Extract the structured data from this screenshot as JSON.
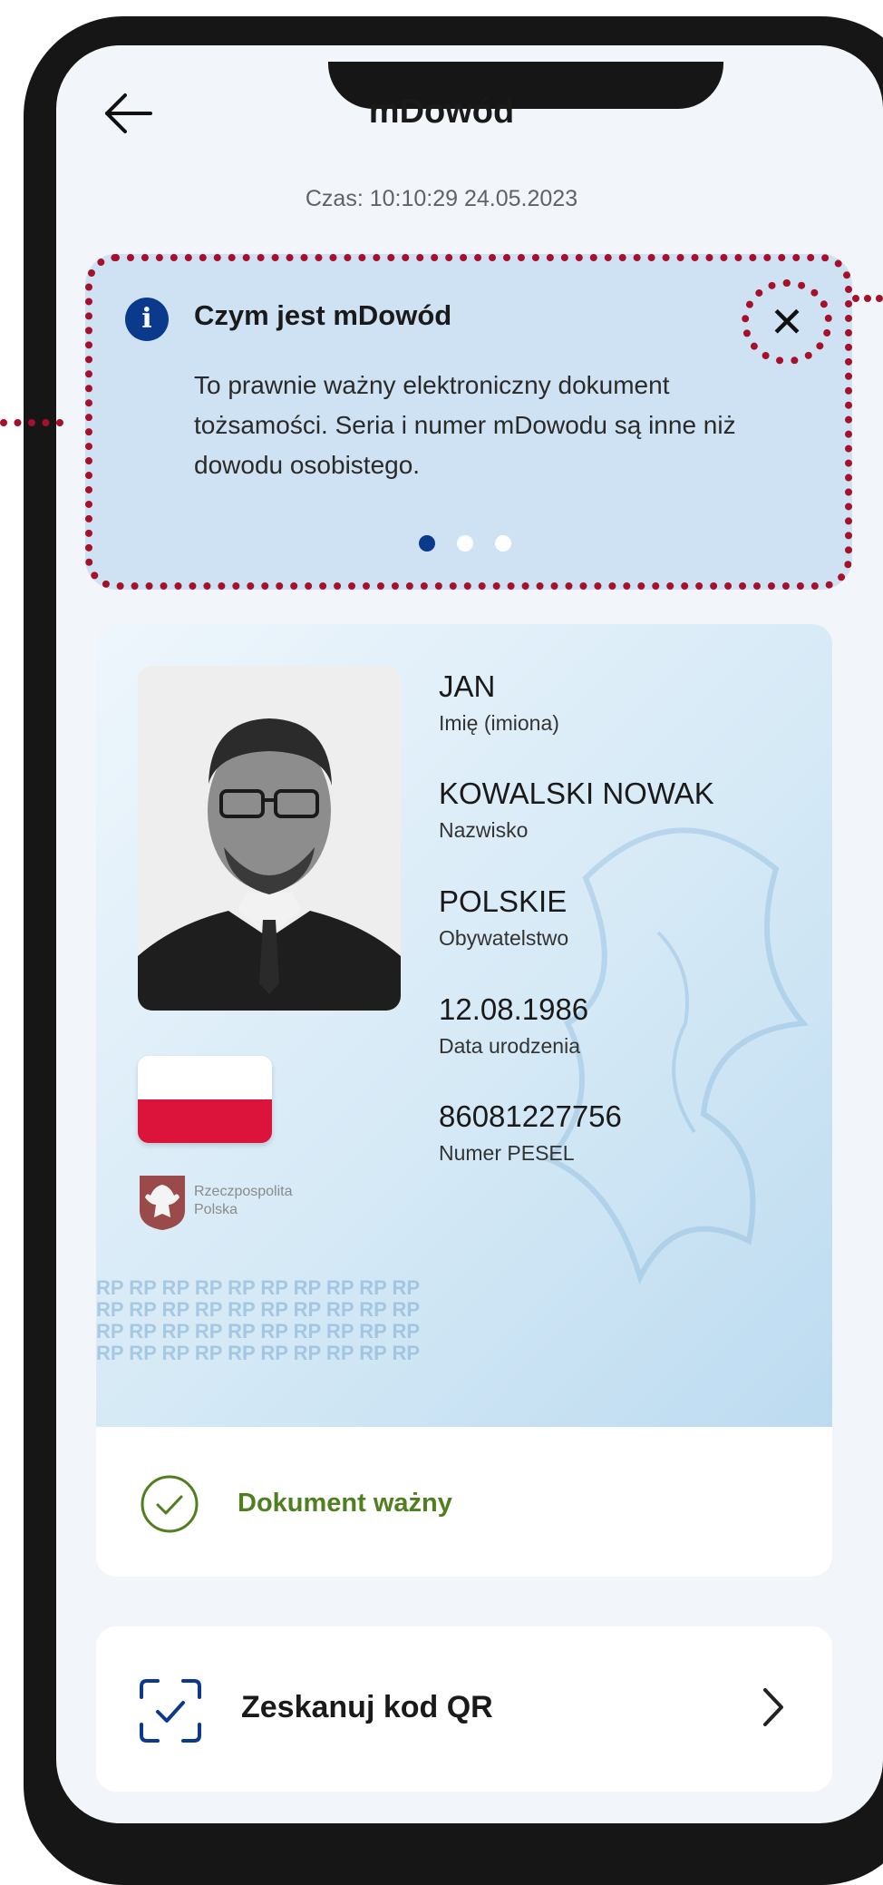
{
  "header": {
    "title": "mDowód",
    "time": "Czas: 10:10:29 24.05.2023"
  },
  "info": {
    "icon": "info-icon",
    "title": "Czym jest mDowód",
    "text": "To prawnie ważny elektroniczny dokument tożsamości. Seria i numer mDowodu są inne niż dowodu osobistego.",
    "close_label": "✕",
    "pages": 3,
    "active_page": 1
  },
  "card": {
    "fields": [
      {
        "value": "JAN",
        "label": "Imię (imiona)"
      },
      {
        "value": "KOWALSKI NOWAK",
        "label": "Nazwisko"
      },
      {
        "value": "POLSKIE",
        "label": "Obywatelstwo"
      },
      {
        "value": "12.08.1986",
        "label": "Data urodzenia"
      },
      {
        "value": "86081227756",
        "label": "Numer PESEL"
      }
    ],
    "emblem_text": "Rzeczpospolita Polska",
    "watermark": "RP RP RP RP RP RP RP RP RP RP RP RP RP RP RP RP RP RP RP RP RP RP RP RP RP RP RP RP RP RP RP RP RP RP RP RP RP RP RP RP"
  },
  "status": {
    "text": "Dokument ważny",
    "color": "#4f7f1f"
  },
  "qr": {
    "label": "Zeskanuj kod QR"
  },
  "colors": {
    "accent": "#0b3a8c",
    "highlight": "#a5102a"
  }
}
